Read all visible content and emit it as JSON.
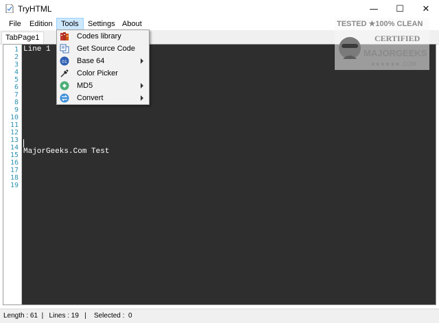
{
  "window": {
    "title": "TryHTML",
    "minimize_glyph": "—",
    "maximize_glyph": "☐",
    "close_glyph": "✕"
  },
  "menu": {
    "file": "File",
    "edition": "Edition",
    "tools": "Tools",
    "settings": "Settings",
    "about": "About"
  },
  "tabs": {
    "tab1": "TabPage1"
  },
  "tools_menu": {
    "items": [
      {
        "label": "Codes library",
        "icon": "books-icon",
        "has_submenu": false
      },
      {
        "label": "Get Source Code",
        "icon": "copy-source-icon",
        "has_submenu": false
      },
      {
        "label": "Base 64",
        "icon": "base64-icon",
        "has_submenu": true
      },
      {
        "label": "Color Picker",
        "icon": "eyedropper-icon",
        "has_submenu": false
      },
      {
        "label": "MD5",
        "icon": "md5-icon",
        "has_submenu": true
      },
      {
        "label": "Convert",
        "icon": "convert-icon",
        "has_submenu": true
      }
    ]
  },
  "editor": {
    "line_numbers": [
      "1",
      "2",
      "3",
      "4",
      "5",
      "6",
      "7",
      "8",
      "9",
      "10",
      "11",
      "12",
      "13",
      "14",
      "15",
      "16",
      "17",
      "18",
      "19"
    ],
    "lines": {
      "line1": "Line 1",
      "line14": "MajorGeeks.Com Test"
    },
    "background": "#2e2e2e",
    "line_number_color": "#2b91af"
  },
  "status": {
    "text": "Length : 61  |   Lines : 19   |    Selected :  0"
  },
  "watermark": {
    "line1": "TESTED ★100% CLEAN",
    "line2": "CERTIFIED",
    "line3": "MAJORGEEKS",
    "line4": "★★★★★★ .COM"
  }
}
